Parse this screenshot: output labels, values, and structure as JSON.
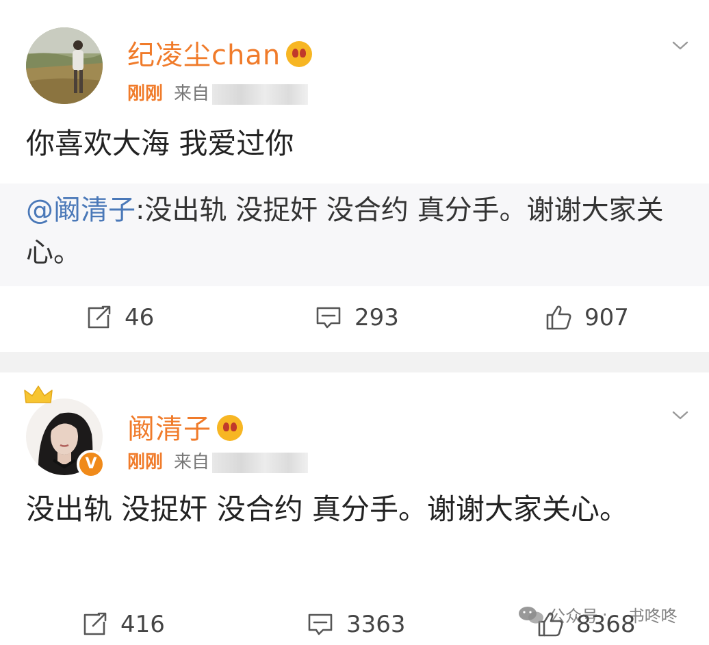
{
  "posts": [
    {
      "username": "纪凌尘chan",
      "time": "刚刚",
      "source_prefix": "来自",
      "content": "你喜欢大海 我爱过你",
      "quote": {
        "mention": "@阚清子",
        "text": ":没出轨 没捉奸 没合约 真分手。谢谢大家关心。"
      },
      "stats": {
        "reposts": "46",
        "comments": "293",
        "likes": "907"
      }
    },
    {
      "username": "阚清子",
      "time": "刚刚",
      "source_prefix": "来自",
      "content": "没出轨 没捉奸 没合约 真分手。谢谢大家关心。",
      "verified_badge": "V",
      "stats": {
        "reposts": "416",
        "comments": "3363",
        "likes": "8368"
      }
    }
  ],
  "watermark": {
    "prefix": "公众号",
    "separator": "·",
    "account": "书咚咚"
  },
  "colors": {
    "username": "#f07b2a",
    "mention": "#4a78b8",
    "divider": "#f2f2f2",
    "badge": "#f08a1a"
  }
}
